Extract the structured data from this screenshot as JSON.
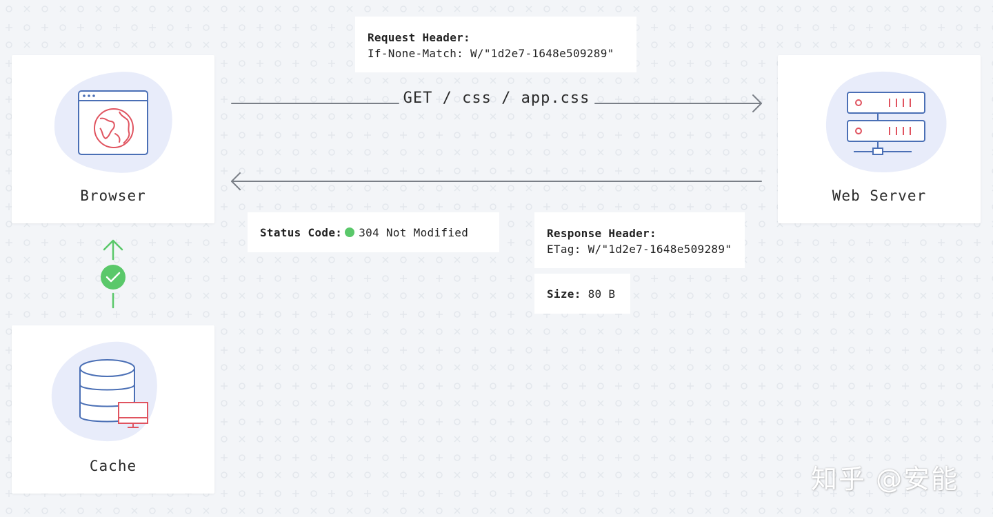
{
  "nodes": {
    "browser": "Browser",
    "server": "Web Server",
    "cache": "Cache"
  },
  "request": {
    "method_path": "GET / css / app.css",
    "header_title": "Request Header:",
    "header_value": "If-None-Match: W/\"1d2e7-1648e509289\""
  },
  "response": {
    "status_label": "Status Code:",
    "status_value": "304 Not Modified",
    "status_color": "#5ac86a",
    "header_title": "Response Header:",
    "header_value": "ETag: W/\"1d2e7-1648e509289\"",
    "size_label": "Size:",
    "size_value": "80 B"
  },
  "cache_link": {
    "state": "valid",
    "icon": "check-circle-icon",
    "color": "#5ac86a"
  },
  "watermark": "知乎 @安能",
  "colors": {
    "background": "#f3f5f8",
    "arrow": "#7a7f87",
    "icon_stroke": "#4a6fb5",
    "icon_accent": "#e0535f",
    "icon_blob": "#e8ecfa"
  }
}
